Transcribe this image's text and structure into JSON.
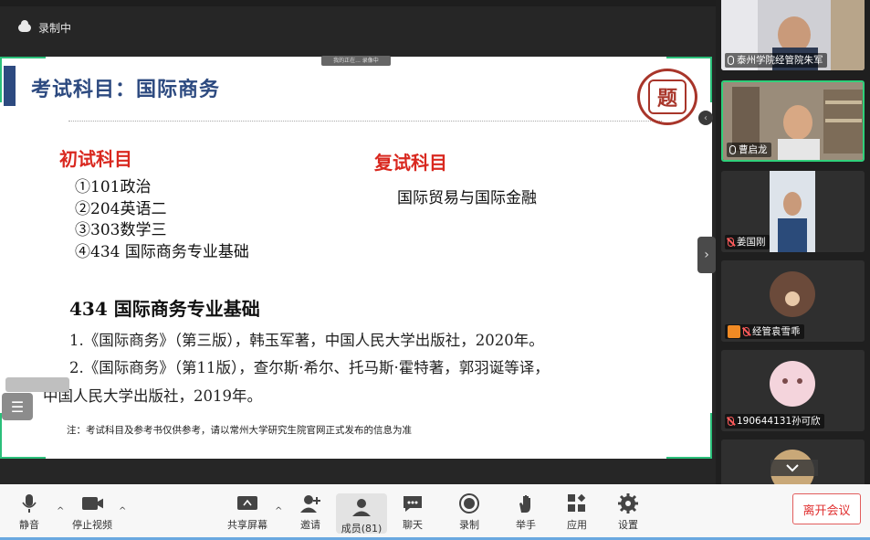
{
  "status": {
    "recording_label": "录制中"
  },
  "share_bar": {
    "label": "我的正在... 录像中"
  },
  "slide": {
    "title": "考试科目：国际商务",
    "initial_heading": "初试科目",
    "initial_items": [
      "①101政治",
      "②204英语二",
      "③303数学三",
      "④434 国际商务专业基础"
    ],
    "retest_heading": "复试科目",
    "retest_subject": "国际贸易与国际金融",
    "ref_heading": "434  国际商务专业基础",
    "ref_1": "1.《国际商务》（第三版），韩玉军著，中国人民大学出版社，2020年。",
    "ref_2": "2.《国际商务》（第11版），查尔斯·希尔、托马斯·霍特著，郭羽诞等译，",
    "ref_3": "中国人民大学出版社，2019年。",
    "note": "注：考试科目及参考书仅供参考，请以常州大学研究生院官网正式发布的信息为准",
    "seal_char": "题"
  },
  "participants": [
    {
      "name": "泰州学院经管院朱军",
      "mic": "on"
    },
    {
      "name": "曹启龙",
      "mic": "on"
    },
    {
      "name": "姜国刚",
      "mic": "muted"
    },
    {
      "name": "经管袁雪乖",
      "mic": "muted",
      "host": true
    },
    {
      "name": "190644131孙可欣",
      "mic": "muted"
    }
  ],
  "toolbar": {
    "mute": "静音",
    "stop_video": "停止视频",
    "share_screen": "共享屏幕",
    "invite": "邀请",
    "members": "成员(81)",
    "chat": "聊天",
    "record": "录制",
    "raise_hand": "举手",
    "apps": "应用",
    "settings": "设置",
    "leave": "离开会议"
  },
  "icons": [
    "cloud-icon",
    "mic-icon",
    "camera-icon",
    "share-screen-icon",
    "invite-icon",
    "members-icon",
    "chat-icon",
    "record-icon",
    "hand-icon",
    "apps-icon",
    "gear-icon",
    "chevron-right-icon",
    "chevron-down-icon",
    "list-icon"
  ]
}
